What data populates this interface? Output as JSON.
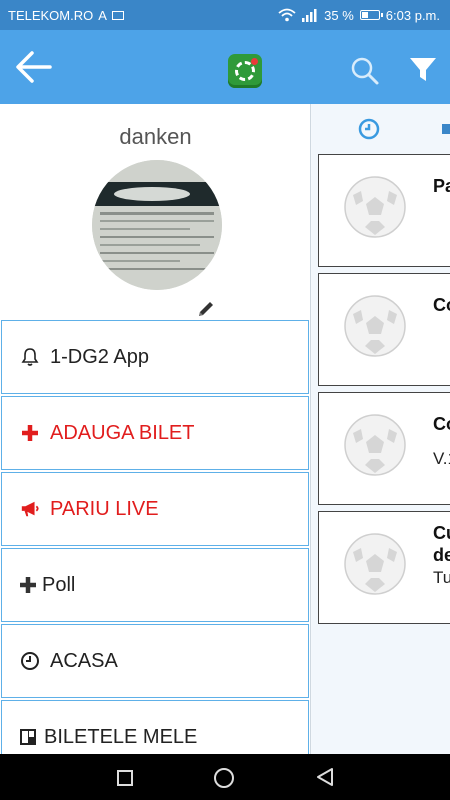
{
  "status_bar": {
    "carrier": "TELEKOM.RO",
    "indicator": "A",
    "battery": "35 %",
    "battery_level": 0.35,
    "time": "6:03 p.m."
  },
  "header": {
    "icons": [
      "back-arrow-icon",
      "app-logo",
      "search-icon",
      "filter-icon"
    ],
    "accent_color": "#4da3e8",
    "status_color": "#3a86c8"
  },
  "profile": {
    "username": "danken"
  },
  "menu": {
    "items": [
      {
        "label": "1-DG2 App",
        "icon": "bell-icon"
      },
      {
        "label": "ADAUGA BILET",
        "icon": "plus-icon",
        "color": "#e11d1d"
      },
      {
        "label": "PARIU LIVE",
        "icon": "megaphone-icon",
        "color": "#e11d1d"
      },
      {
        "label": "Poll",
        "icon": "plus-icon"
      },
      {
        "label": "ACASA",
        "icon": "clock-icon"
      },
      {
        "label": "BILETELE MELE",
        "icon": "board-icon"
      }
    ]
  },
  "feed": {
    "tabs": [
      "clock-icon",
      "tab-icon"
    ],
    "cards": [
      {
        "title": "Pa",
        "subtitle": ""
      },
      {
        "title": "Co",
        "subtitle": ""
      },
      {
        "title": "Co",
        "subtitle": "V.1"
      },
      {
        "title": "Cu",
        "title2": "de",
        "subtitle": "Tu"
      }
    ]
  },
  "navbar": {
    "icons": [
      "recent-apps-icon",
      "home-icon",
      "back-icon"
    ]
  }
}
